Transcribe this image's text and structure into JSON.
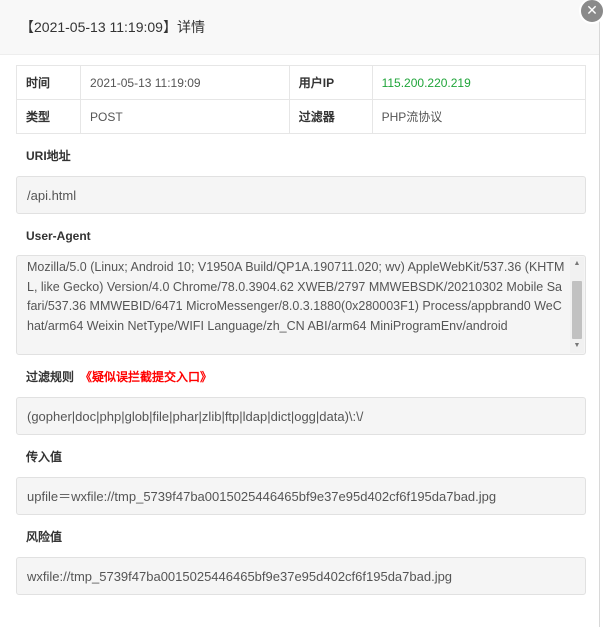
{
  "header": {
    "title": "【2021-05-13 11:19:09】详情"
  },
  "info": {
    "time_label": "时间",
    "time_value": "2021-05-13 11:19:09",
    "ip_label": "用户IP",
    "ip_value": "115.200.220.219",
    "type_label": "类型",
    "type_value": "POST",
    "filter_label": "过滤器",
    "filter_value": "PHP流协议"
  },
  "uri": {
    "label": "URI地址",
    "value": "/api.html"
  },
  "user_agent": {
    "label": "User-Agent",
    "value": "Mozilla/5.0 (Linux; Android 10; V1950A Build/QP1A.190711.020; wv) AppleWebKit/537.36 (KHTML, like Gecko) Version/4.0 Chrome/78.0.3904.62 XWEB/2797 MMWEBSDK/20210302 Mobile Safari/537.36 MMWEBID/6471 MicroMessenger/8.0.3.1880(0x280003F1) Process/appbrand0 WeChat/arm64 Weixin NetType/WIFI Language/zh_CN ABI/arm64 MiniProgramEnv/android"
  },
  "rule": {
    "label": "过滤规则",
    "link": "《疑似误拦截提交入口》",
    "value": "(gopher|doc|php|glob|file|phar|zlib|ftp|ldap|dict|ogg|data)\\:\\/"
  },
  "input": {
    "label": "传入值",
    "value": "upfile＝wxfile://tmp_5739f47ba0015025446465bf9e37e95d402cf6f195da7bad.jpg"
  },
  "risk": {
    "label": "风险值",
    "value": "wxfile://tmp_5739f47ba0015025446465bf9e37e95d402cf6f195da7bad.jpg"
  },
  "icons": {
    "close": "close-icon"
  },
  "colors": {
    "ip": "#20a53a",
    "warning": "#ff0000"
  }
}
